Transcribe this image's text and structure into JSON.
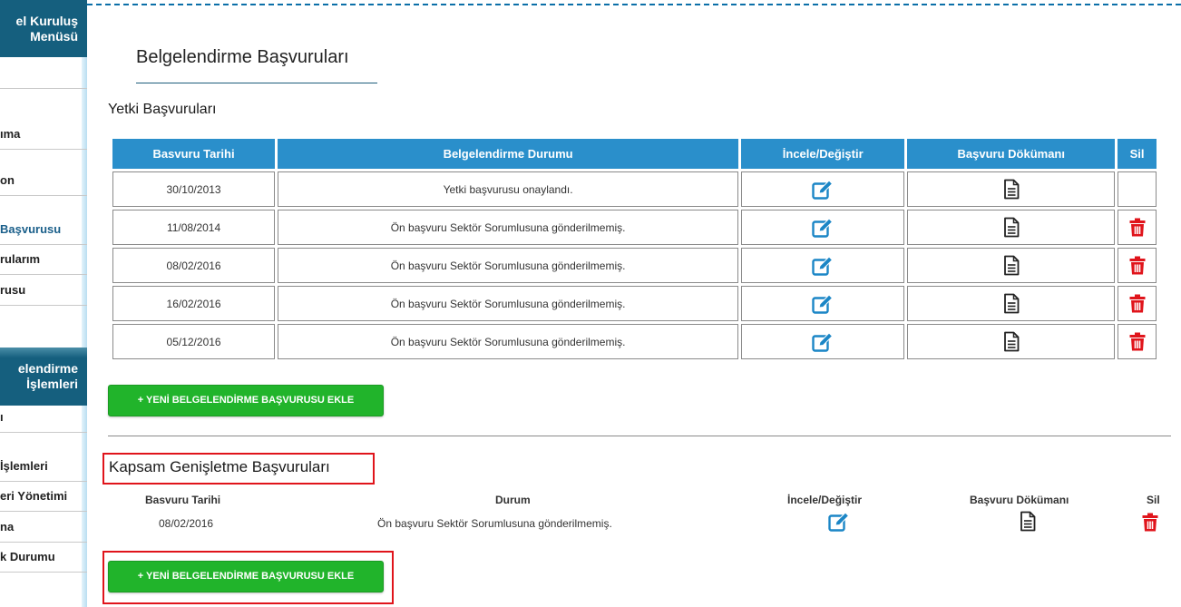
{
  "sidebar": {
    "header1": [
      "el Kuruluş",
      "Menüsü"
    ],
    "items_top": [
      "ıma",
      "on",
      "Başvurusu",
      "rularım",
      "rusu"
    ],
    "header2": [
      "elendirme",
      "İşlemleri"
    ],
    "items_bottom": [
      "ı",
      "İşlemleri",
      "eri Yönetimi",
      "na",
      "k Durumu"
    ]
  },
  "page_title": "Belgelendirme Başvuruları",
  "yetki": {
    "title": "Yetki Başvuruları",
    "columns": [
      "Basvuru Tarihi",
      "Belgelendirme Durumu",
      "İncele/Değiştir",
      "Başvuru Dökümanı",
      "Sil"
    ],
    "rows": [
      {
        "date": "30/10/2013",
        "status": "Yetki başvurusu onaylandı.",
        "deletable": false
      },
      {
        "date": "11/08/2014",
        "status": "Ön başvuru Sektör Sorumlusuna gönderilmemiş.",
        "deletable": true
      },
      {
        "date": "08/02/2016",
        "status": "Ön başvuru Sektör Sorumlusuna gönderilmemiş.",
        "deletable": true
      },
      {
        "date": "16/02/2016",
        "status": "Ön başvuru Sektör Sorumlusuna gönderilmemiş.",
        "deletable": true
      },
      {
        "date": "05/12/2016",
        "status": "Ön başvuru Sektör Sorumlusuna gönderilmemiş.",
        "deletable": true
      }
    ],
    "add_button": "+ YENİ BELGELENDİRME BAŞVURUSU EKLE"
  },
  "kapsam": {
    "title": "Kapsam Genişletme Başvuruları",
    "columns": {
      "date": "Basvuru Tarihi",
      "status": "Durum",
      "edit": "İncele/Değiştir",
      "doc": "Başvuru Dökümanı",
      "delete": "Sil"
    },
    "row": {
      "date": "08/02/2016",
      "status": "Ön başvuru Sektör Sorumlusuna gönderilmemiş."
    },
    "add_button": "+ YENİ BELGELENDİRME BAŞVURUSU EKLE"
  },
  "icons": {
    "edit": "edit-icon",
    "doc": "document-icon",
    "delete": "trash-icon"
  },
  "colors": {
    "header_blue": "#2a8fcb",
    "sidebar_dark": "#155f7e",
    "button_green": "#21b42b",
    "delete_red": "#e0141b",
    "highlight_red": "#e0141b"
  }
}
